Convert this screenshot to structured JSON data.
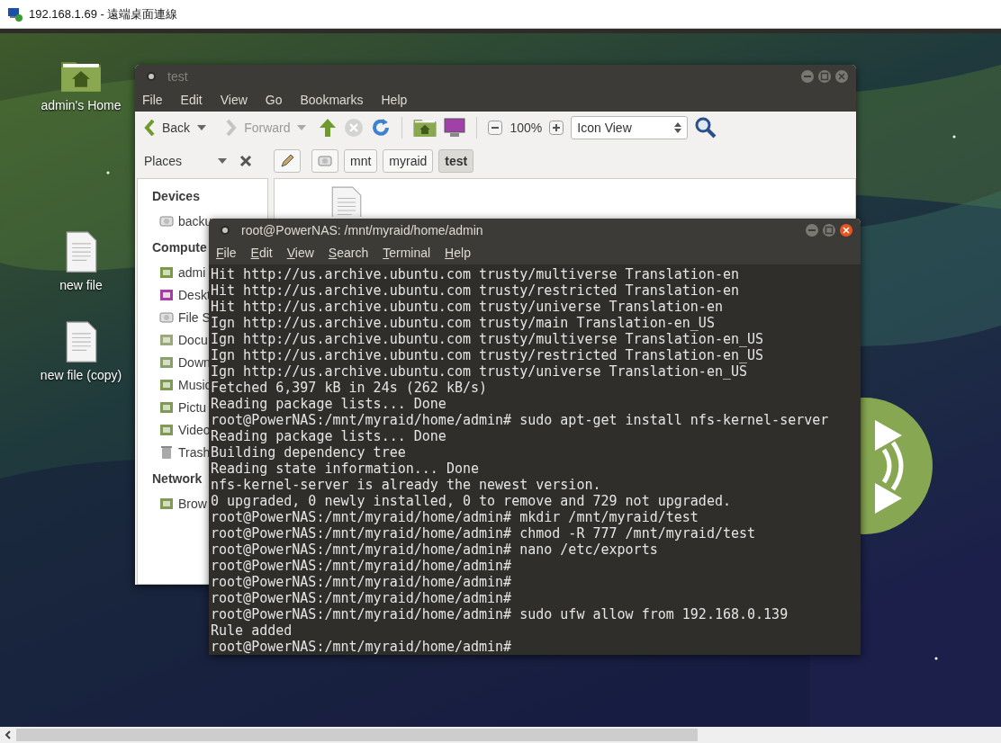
{
  "rdp_window": {
    "title": "192.168.1.69 - 遠端桌面連線"
  },
  "desktop_icons": [
    {
      "label": "admin's Home",
      "kind": "home"
    },
    {
      "label": "new file",
      "kind": "file"
    },
    {
      "label": "new file (copy)",
      "kind": "file"
    }
  ],
  "file_manager": {
    "title": "test",
    "menu": [
      "File",
      "Edit",
      "View",
      "Go",
      "Bookmarks",
      "Help"
    ],
    "back": {
      "label": "Back",
      "disabled": false
    },
    "forward": {
      "label": "Forward",
      "disabled": true
    },
    "zoom": "100%",
    "view_mode": "Icon View",
    "places_label": "Places",
    "path": [
      {
        "label": "mnt",
        "selected": false
      },
      {
        "label": "myraid",
        "selected": false
      },
      {
        "label": "test",
        "selected": true
      }
    ],
    "sidebar": [
      {
        "heading": "Devices",
        "items": [
          {
            "label": "backu",
            "kind": "drive"
          }
        ]
      },
      {
        "heading": "Compute",
        "items": [
          {
            "label": "admi",
            "kind": "home"
          },
          {
            "label": "Deskt",
            "kind": "desktop"
          },
          {
            "label": "File S",
            "kind": "drive"
          },
          {
            "label": "Docu",
            "kind": "documents"
          },
          {
            "label": "Down",
            "kind": "downloads"
          },
          {
            "label": "Music",
            "kind": "music"
          },
          {
            "label": "Pictu",
            "kind": "pictures"
          },
          {
            "label": "Video",
            "kind": "videos"
          },
          {
            "label": "Trash",
            "kind": "trash"
          }
        ]
      },
      {
        "heading": "Network",
        "items": [
          {
            "label": "Brow",
            "kind": "network"
          }
        ]
      }
    ]
  },
  "terminal": {
    "title": "root@PowerNAS: /mnt/myraid/home/admin",
    "menu": [
      "File",
      "Edit",
      "View",
      "Search",
      "Terminal",
      "Help"
    ],
    "lines": [
      "Hit http://us.archive.ubuntu.com trusty/multiverse Translation-en",
      "Hit http://us.archive.ubuntu.com trusty/restricted Translation-en",
      "Hit http://us.archive.ubuntu.com trusty/universe Translation-en",
      "Ign http://us.archive.ubuntu.com trusty/main Translation-en_US",
      "Ign http://us.archive.ubuntu.com trusty/multiverse Translation-en_US",
      "Ign http://us.archive.ubuntu.com trusty/restricted Translation-en_US",
      "Ign http://us.archive.ubuntu.com trusty/universe Translation-en_US",
      "Fetched 6,397 kB in 24s (262 kB/s)",
      "Reading package lists... Done",
      "root@PowerNAS:/mnt/myraid/home/admin# sudo apt-get install nfs-kernel-server",
      "Reading package lists... Done",
      "Building dependency tree",
      "Reading state information... Done",
      "nfs-kernel-server is already the newest version.",
      "0 upgraded, 0 newly installed, 0 to remove and 729 not upgraded.",
      "root@PowerNAS:/mnt/myraid/home/admin# mkdir /mnt/myraid/test",
      "root@PowerNAS:/mnt/myraid/home/admin# chmod -R 777 /mnt/myraid/test",
      "root@PowerNAS:/mnt/myraid/home/admin# nano /etc/exports",
      "root@PowerNAS:/mnt/myraid/home/admin#",
      "root@PowerNAS:/mnt/myraid/home/admin#",
      "root@PowerNAS:/mnt/myraid/home/admin#",
      "root@PowerNAS:/mnt/myraid/home/admin# sudo ufw allow from 192.168.0.139",
      "Rule added",
      "root@PowerNAS:/mnt/myraid/home/admin#"
    ]
  }
}
